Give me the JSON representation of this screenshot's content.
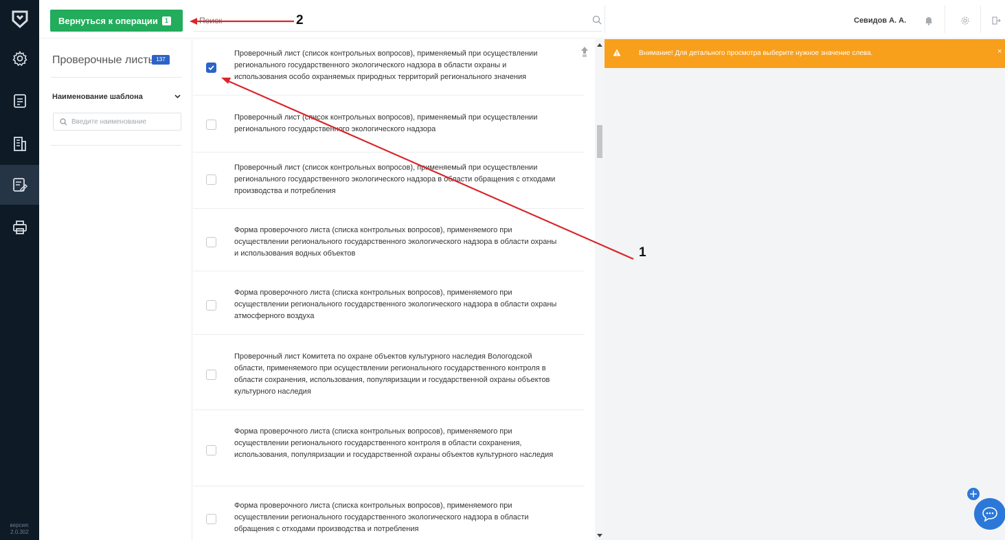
{
  "sidebar": {
    "items": [
      {
        "name": "settings-icon"
      },
      {
        "name": "document-icon"
      },
      {
        "name": "building-icon"
      },
      {
        "name": "checklist-edit-icon"
      },
      {
        "name": "printer-icon"
      }
    ],
    "active_index": 3,
    "version_label": "версия:",
    "version_number": "2.0.302"
  },
  "header": {
    "back_button_label": "Вернуться к операции",
    "back_button_count": "1",
    "search_placeholder": "Поиск",
    "user_name": "Севидов А. А."
  },
  "filter": {
    "title": "Проверочные листы",
    "count": "137",
    "field_label": "Наименование шаблона",
    "input_placeholder": "Введите наименование"
  },
  "list": {
    "items": [
      {
        "text": "Проверочный лист (список контрольных вопросов), применяемый при осуществлении регионального государственного экологического надзора в области охраны и использования особо охраняемых природных территорий регионального значения",
        "checked": true
      },
      {
        "text": "Проверочный лист (список контрольных вопросов), применяемый при осуществлении регионального государственного экологического надзора",
        "checked": false
      },
      {
        "text": "Проверочный лист (список контрольных вопросов), применяемый при осуществлении регионального государственного экологического надзора в области обращения с отходами производства и потребления",
        "checked": false
      },
      {
        "text": "Форма проверочного листа (списка контрольных вопросов), применяемого при осуществлении регионального государственного экологического надзора в области охраны и использования водных объектов",
        "checked": false
      },
      {
        "text": "Форма проверочного листа (списка контрольных вопросов), применяемого при осуществлении регионального государственного экологического надзора в области охраны атмосферного воздуха",
        "checked": false
      },
      {
        "text": "Проверочный лист Комитета по охране объектов культурного наследия Вологодской области, применяемого при осуществлении регионального государственного контроля в области сохранения, использования, популяризации и государственной охраны объектов культурного наследия",
        "checked": false
      },
      {
        "text": "Форма проверочного листа (списка контрольных вопросов), применяемого при осуществлении регионального государственного контроля в области сохранения, использования, популяризации и государственной охраны объектов культурного наследия",
        "checked": false
      },
      {
        "text": "Форма проверочного листа (списка контрольных вопросов), применяемого при осуществлении регионального государственного экологического надзора в области обращения с отходами производства и потребления",
        "checked": false
      }
    ]
  },
  "detail": {
    "warning_text": "Внимание! Для детального просмотра выберите нужное значение слева.",
    "close_label": "×"
  },
  "annotations": {
    "label_1": "1",
    "label_2": "2"
  },
  "colors": {
    "sidebar_bg": "#0e1a26",
    "sidebar_active": "#253546",
    "primary_green": "#22ac5c",
    "badge_blue": "#2b64c5",
    "warning_orange": "#f89f1b",
    "arrow_red": "#d9262c"
  }
}
